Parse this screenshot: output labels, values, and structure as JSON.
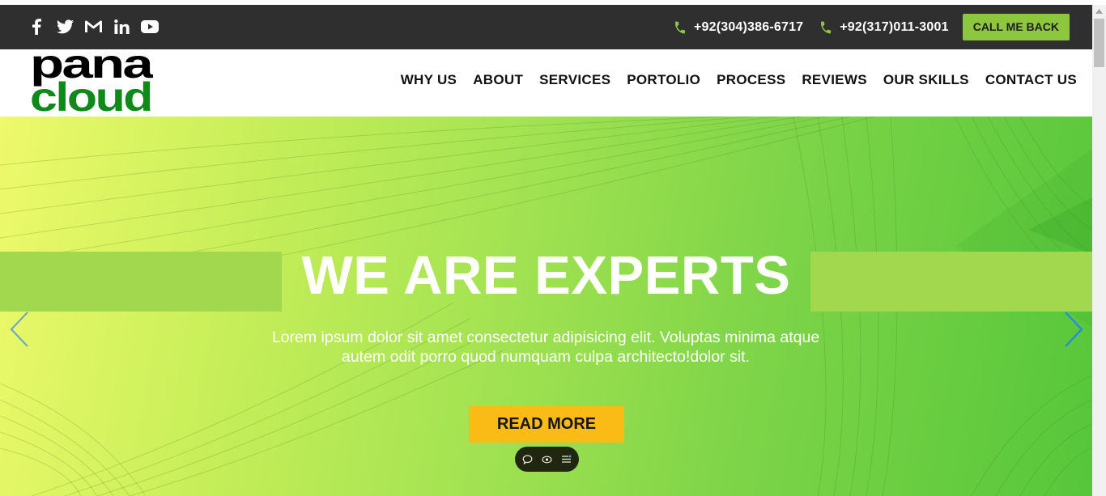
{
  "topbar": {
    "social_icons": [
      "facebook-icon",
      "twitter-icon",
      "gmail-icon",
      "linkedin-icon",
      "youtube-icon"
    ],
    "phones": [
      "+92(304)386-6717",
      "+92(317)011-3001"
    ],
    "callback_label": "CALL ME BACK"
  },
  "navbar": {
    "logo_text": [
      "pana",
      "cloud"
    ],
    "items": [
      "WHY US",
      "ABOUT",
      "SERVICES",
      "PORTOLIO",
      "PROCESS",
      "REVIEWS",
      "OUR SKILLS",
      "CONTACT US"
    ]
  },
  "hero": {
    "title": "WE ARE EXPERTS",
    "subtitle_line1": "Lorem ipsum dolor sit amet consectetur adipisicing elit. Voluptas minima atque",
    "subtitle_line2": "autem odit porro quod numquam culpa architecto!dolor sit.",
    "button_label": "READ MORE"
  },
  "colors": {
    "topbar_bg": "#2f2f2f",
    "accent_green": "#8dc63f",
    "logo_green": "#0f8a1a",
    "button_yellow": "#fbbb17",
    "band_green": "#a2d84e",
    "arrow_blue": "#2a8fd6"
  },
  "mini_toolbar_icons": [
    "comment-icon",
    "eye-icon",
    "menu-icon"
  ]
}
